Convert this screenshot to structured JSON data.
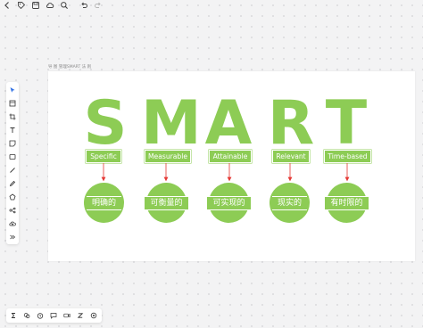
{
  "toolbar": {
    "icons": [
      "back-icon",
      "tag-icon",
      "save-icon",
      "cloud-icon",
      "search-icon",
      "undo-icon",
      "redo-icon"
    ]
  },
  "canvas": {
    "title": "导 图 管理SMART 法 则"
  },
  "left_tools": [
    "select-icon",
    "frame-icon",
    "crop-icon",
    "text-icon",
    "sticky-note-icon",
    "rectangle-icon",
    "line-icon",
    "pen-icon",
    "shape-icon",
    "mindmap-icon",
    "upload-icon",
    "more-icon"
  ],
  "bottom_tools": [
    "template-icon",
    "comment-icon",
    "timer-icon",
    "chat-icon",
    "video-icon",
    "z-icon",
    "settings-icon"
  ],
  "smart": {
    "letters": [
      "S",
      "M",
      "A",
      "R",
      "T"
    ],
    "labels": [
      "Specific",
      "Measurable",
      "Attainable",
      "Relevant",
      "Time-based"
    ],
    "circles": [
      "明确的",
      "可衡量的",
      "可实现的",
      "现实的",
      "有时限的"
    ],
    "colors": {
      "green": "#8dcc55",
      "arrow": "#e53935"
    }
  }
}
